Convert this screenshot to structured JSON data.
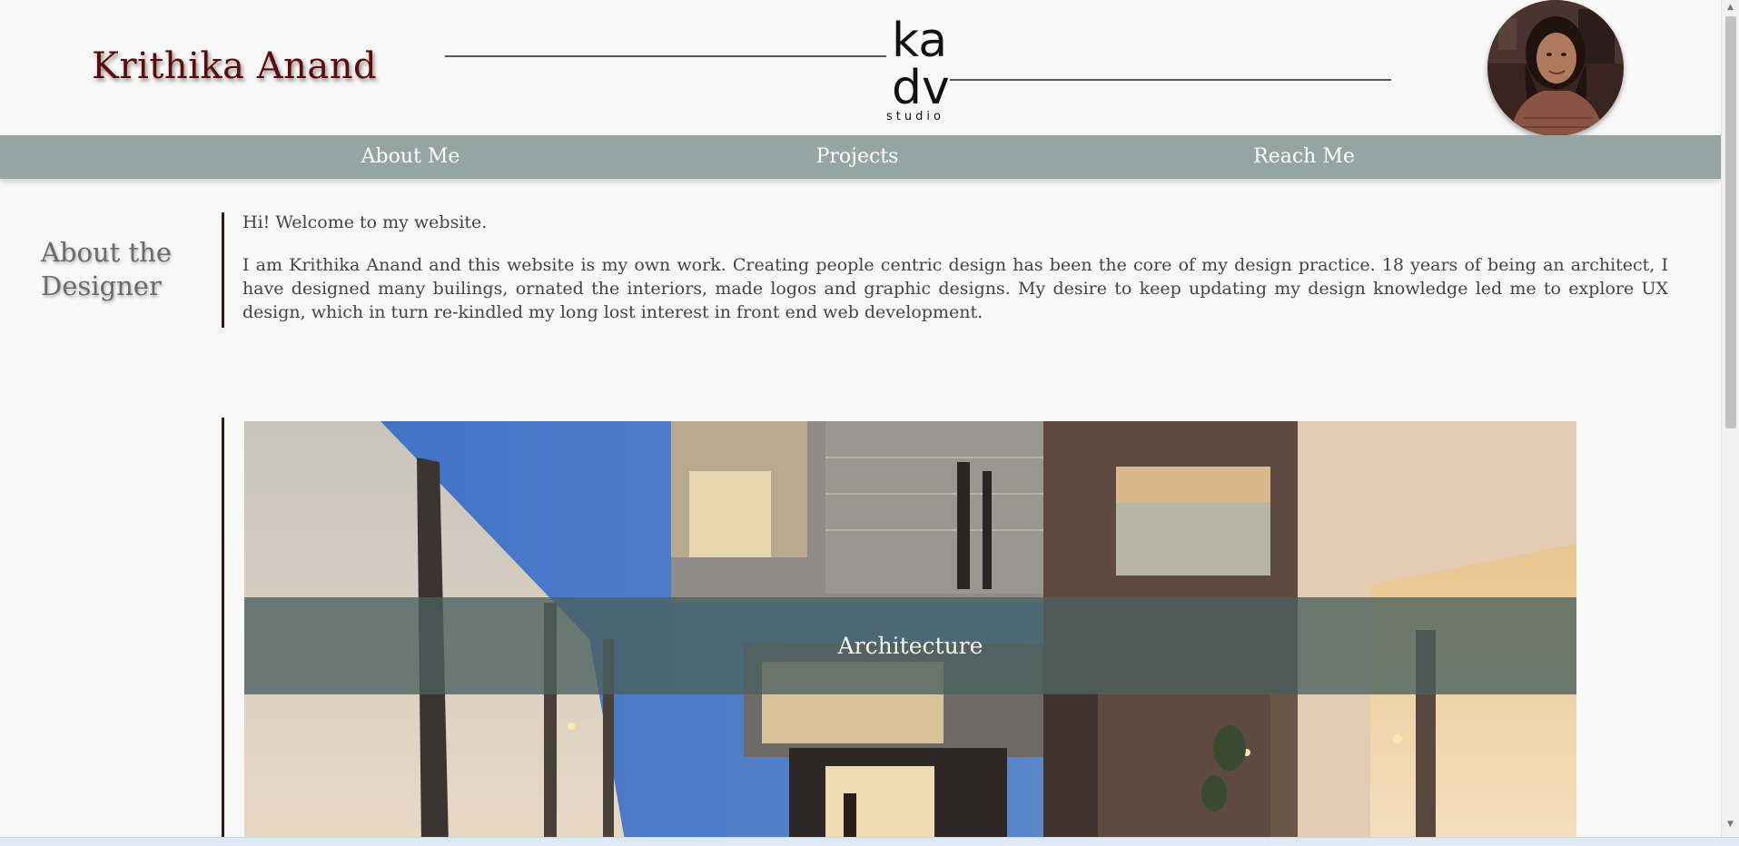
{
  "header": {
    "site_name": "Krithika Anand",
    "logo_text": {
      "line1": "ka",
      "line2": "dv",
      "line3": "studio"
    }
  },
  "nav": {
    "items": [
      {
        "label": "About Me"
      },
      {
        "label": "Projects"
      },
      {
        "label": "Reach Me"
      }
    ]
  },
  "about": {
    "heading_line1": "About the",
    "heading_line2": "Designer",
    "greeting": "Hi! Welcome to my website.",
    "body": "I am Krithika Anand and this website is my own work. Creating people centric design has been the core of my design practice. 18 years of being an architect, I have designed many builings, ornated the interiors, made logos and graphic designs. My desire to keep updating my design knowledge led me to explore UX design, which in turn re-kindled my long lost interest in front end web development."
  },
  "projects": {
    "items": [
      {
        "label": "Architecture"
      }
    ]
  },
  "colors": {
    "name_color": "#5e0a0a",
    "nav_bg": "#95a5a2",
    "accent_rule": "#3e1414",
    "banner_bg": "#4a605e"
  },
  "icons": {
    "scroll_up": "scroll-up-arrow-icon",
    "scroll_down": "scroll-down-arrow-icon"
  }
}
